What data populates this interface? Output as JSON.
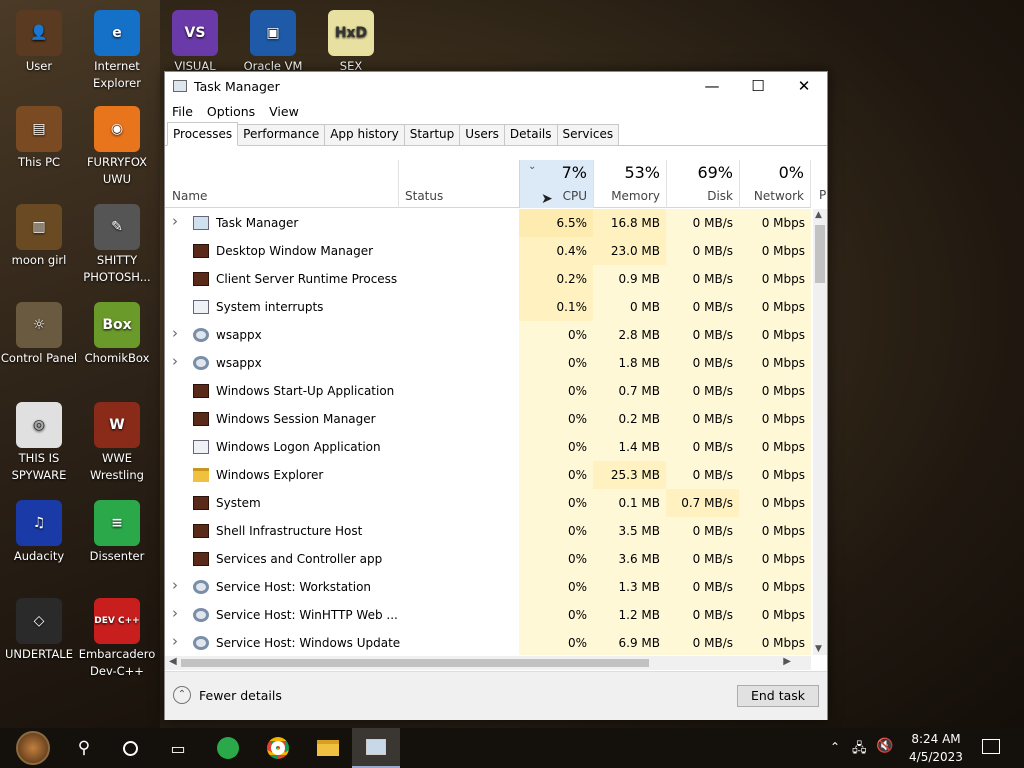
{
  "desktop_icons": [
    {
      "label": "User",
      "color": "#5a3a20",
      "glyph": "👤"
    },
    {
      "label": "Internet\nExplorer",
      "color": "#1570c8",
      "glyph": "e"
    },
    {
      "label": "VISUAL",
      "color": "#6a3aa8",
      "glyph": "VS"
    },
    {
      "label": "Oracle VM",
      "color": "#1e5aa8",
      "glyph": "▣"
    },
    {
      "label": "SEX",
      "color": "#e8e0a0",
      "glyph": "HxD"
    },
    {
      "label": "This PC",
      "color": "#7a4a22",
      "glyph": "▤"
    },
    {
      "label": "FURRYFOX\nUWU",
      "color": "#e8741c",
      "glyph": "◉"
    },
    {
      "label": "moon girl",
      "color": "#6a4a22",
      "glyph": "▥"
    },
    {
      "label": "SHITTY\nPHOTOSH...",
      "color": "#555555",
      "glyph": "✎"
    },
    {
      "label": "Control Panel",
      "color": "#6a5a40",
      "glyph": "☼"
    },
    {
      "label": "ChomikBox",
      "color": "#6a9a2a",
      "glyph": "Box"
    },
    {
      "label": "THIS IS\nSPYWARE",
      "color": "#e0e0e0",
      "glyph": "◎"
    },
    {
      "label": "WWE\nWrestling",
      "color": "#8a2a18",
      "glyph": "W"
    },
    {
      "label": "Audacity",
      "color": "#1a3aa8",
      "glyph": "♫"
    },
    {
      "label": "Dissenter",
      "color": "#2aa84a",
      "glyph": "≡"
    },
    {
      "label": "UNDERTALE",
      "color": "#2a2a2a",
      "glyph": "◇"
    },
    {
      "label": "Embarcadero\nDev-C++",
      "color": "#c81e1e",
      "glyph": "DEV C++"
    }
  ],
  "window": {
    "title": "Task Manager",
    "min": "—",
    "max": "☐",
    "close": "✕"
  },
  "menu": [
    "File",
    "Options",
    "View"
  ],
  "tabs": [
    "Processes",
    "Performance",
    "App history",
    "Startup",
    "Users",
    "Details",
    "Services"
  ],
  "columns": {
    "name": "Name",
    "status": "Status",
    "cpu": {
      "pct": "7%",
      "label": "CPU"
    },
    "memory": {
      "pct": "53%",
      "label": "Memory"
    },
    "disk": {
      "pct": "69%",
      "label": "Disk"
    },
    "network": {
      "pct": "0%",
      "label": "Network"
    },
    "power_partial": "P"
  },
  "processes": [
    {
      "name": "Task Manager",
      "expand": true,
      "icon": "tm",
      "cpu": "6.5%",
      "memory": "16.8 MB",
      "disk": "0 MB/s",
      "network": "0 Mbps"
    },
    {
      "name": "Desktop Window Manager",
      "expand": false,
      "icon": "sys",
      "cpu": "0.4%",
      "memory": "23.0 MB",
      "disk": "0 MB/s",
      "network": "0 Mbps"
    },
    {
      "name": "Client Server Runtime Process",
      "expand": false,
      "icon": "sys",
      "cpu": "0.2%",
      "memory": "0.9 MB",
      "disk": "0 MB/s",
      "network": "0 Mbps"
    },
    {
      "name": "System interrupts",
      "expand": false,
      "icon": "app",
      "cpu": "0.1%",
      "memory": "0 MB",
      "disk": "0 MB/s",
      "network": "0 Mbps"
    },
    {
      "name": "wsappx",
      "expand": true,
      "icon": "gear",
      "cpu": "0%",
      "memory": "2.8 MB",
      "disk": "0 MB/s",
      "network": "0 Mbps"
    },
    {
      "name": "wsappx",
      "expand": true,
      "icon": "gear",
      "cpu": "0%",
      "memory": "1.8 MB",
      "disk": "0 MB/s",
      "network": "0 Mbps"
    },
    {
      "name": "Windows Start-Up Application",
      "expand": false,
      "icon": "sys",
      "cpu": "0%",
      "memory": "0.7 MB",
      "disk": "0 MB/s",
      "network": "0 Mbps"
    },
    {
      "name": "Windows Session Manager",
      "expand": false,
      "icon": "sys",
      "cpu": "0%",
      "memory": "0.2 MB",
      "disk": "0 MB/s",
      "network": "0 Mbps"
    },
    {
      "name": "Windows Logon Application",
      "expand": false,
      "icon": "app",
      "cpu": "0%",
      "memory": "1.4 MB",
      "disk": "0 MB/s",
      "network": "0 Mbps"
    },
    {
      "name": "Windows Explorer",
      "expand": false,
      "icon": "folder",
      "cpu": "0%",
      "memory": "25.3 MB",
      "disk": "0 MB/s",
      "network": "0 Mbps"
    },
    {
      "name": "System",
      "expand": false,
      "icon": "sys",
      "cpu": "0%",
      "memory": "0.1 MB",
      "disk": "0.7 MB/s",
      "network": "0 Mbps"
    },
    {
      "name": "Shell Infrastructure Host",
      "expand": false,
      "icon": "sys",
      "cpu": "0%",
      "memory": "3.5 MB",
      "disk": "0 MB/s",
      "network": "0 Mbps"
    },
    {
      "name": "Services and Controller app",
      "expand": false,
      "icon": "sys",
      "cpu": "0%",
      "memory": "3.6 MB",
      "disk": "0 MB/s",
      "network": "0 Mbps"
    },
    {
      "name": "Service Host: Workstation",
      "expand": true,
      "icon": "gear",
      "cpu": "0%",
      "memory": "1.3 MB",
      "disk": "0 MB/s",
      "network": "0 Mbps"
    },
    {
      "name": "Service Host: WinHTTP Web ...",
      "expand": true,
      "icon": "gear",
      "cpu": "0%",
      "memory": "1.2 MB",
      "disk": "0 MB/s",
      "network": "0 Mbps"
    },
    {
      "name": "Service Host: Windows Update",
      "expand": true,
      "icon": "gear",
      "cpu": "0%",
      "memory": "6.9 MB",
      "disk": "0 MB/s",
      "network": "0 Mbps"
    }
  ],
  "footer": {
    "fewer_details": "Fewer details",
    "end_task": "End task"
  },
  "taskbar": {
    "time": "8:24 AM",
    "date": "4/5/2023"
  },
  "colors": {
    "heat_low": "#fff8d6",
    "heat_mid": "#fff2c0",
    "heat_high": "#fdebb0",
    "sort_header": "#dce9f6"
  }
}
